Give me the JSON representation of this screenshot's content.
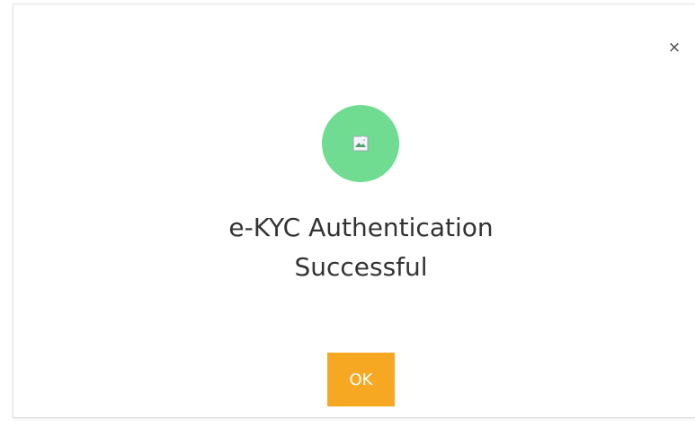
{
  "dialog": {
    "close_label": "×",
    "status_icon": "broken-image-icon",
    "title_line_1": "e-KYC Authentication",
    "title_line_2": "Successful",
    "ok_label": "OK"
  },
  "colors": {
    "success_circle": "#6fdc92",
    "ok_button": "#f7a823",
    "ok_text": "#ffffff",
    "title_text": "#333333",
    "close_icon": "#444444"
  }
}
